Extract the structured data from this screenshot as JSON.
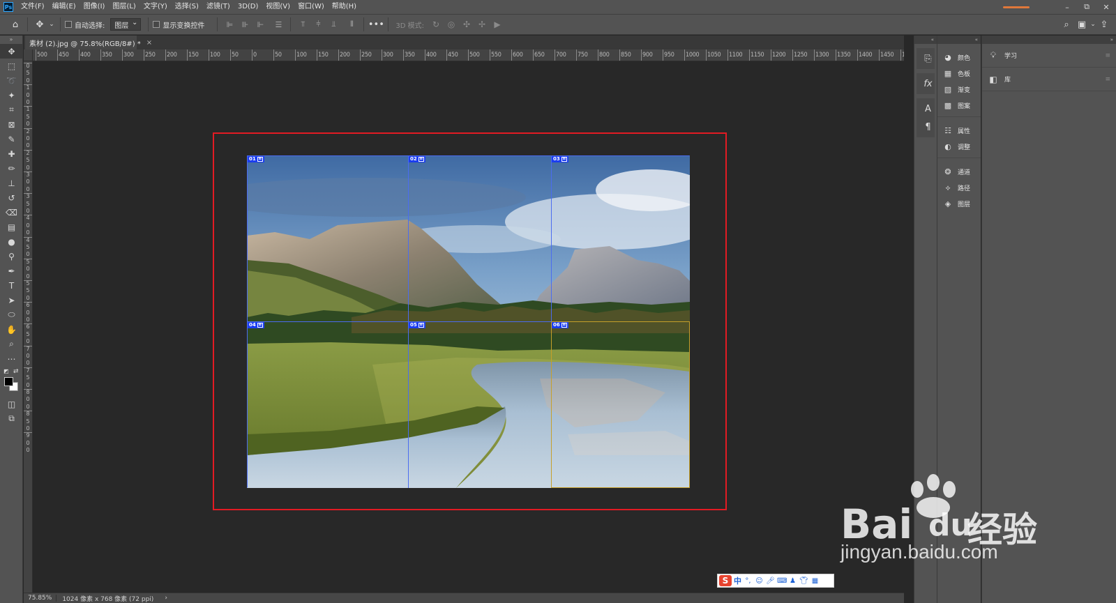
{
  "app": {
    "logo": "Ps"
  },
  "menu": [
    "文件(F)",
    "编辑(E)",
    "图像(I)",
    "图层(L)",
    "文字(Y)",
    "选择(S)",
    "滤镜(T)",
    "3D(D)",
    "视图(V)",
    "窗口(W)",
    "帮助(H)"
  ],
  "window_controls": {
    "minimize": "–",
    "restore": "⧉",
    "close": "✕"
  },
  "options": {
    "auto_select_label": "自动选择:",
    "auto_select_target": "图层",
    "show_transform_label": "显示变换控件",
    "more": "•••",
    "mode_3d_label": "3D 模式:"
  },
  "document": {
    "tab_title": "素材 (2).jpg @ 75.8%(RGB/8#) *",
    "tab_close": "×",
    "zoom": "75.85%",
    "info": "1024 像素 x 768 像素 (72 ppi)",
    "info_more": "›"
  },
  "ruler_h": [
    "500",
    "450",
    "400",
    "350",
    "300",
    "250",
    "200",
    "150",
    "100",
    "50",
    "0",
    "50",
    "100",
    "150",
    "200",
    "250",
    "300",
    "350",
    "400",
    "450",
    "500",
    "550",
    "600",
    "650",
    "700",
    "750",
    "800",
    "850",
    "900",
    "950",
    "1000",
    "1050",
    "1100",
    "1150",
    "1200",
    "1250",
    "1300",
    "1350",
    "1400",
    "1450",
    "15"
  ],
  "ruler_v": [
    "0",
    "5",
    "0",
    "1",
    "0",
    "0",
    "1",
    "5",
    "0",
    "2",
    "0",
    "0",
    "2",
    "5",
    "0",
    "3",
    "0",
    "0",
    "3",
    "5",
    "0",
    "4",
    "0",
    "0",
    "4",
    "5",
    "0",
    "5",
    "0",
    "0",
    "5",
    "5",
    "0",
    "6",
    "0",
    "0",
    "6",
    "5",
    "0",
    "7",
    "0",
    "0",
    "7",
    "5",
    "0",
    "8",
    "0",
    "0",
    "8",
    "5",
    "0",
    "9",
    "0",
    "0"
  ],
  "slices": [
    {
      "id": "01",
      "icon": "⊠"
    },
    {
      "id": "02",
      "icon": "⊠"
    },
    {
      "id": "03",
      "icon": "⊠"
    },
    {
      "id": "04",
      "icon": "⊠"
    },
    {
      "id": "05",
      "icon": "⊠"
    },
    {
      "id": "06",
      "icon": "⊠"
    }
  ],
  "panel_dock": {
    "group1": [
      "颜色",
      "色板",
      "渐变",
      "图案"
    ],
    "group2": [
      "属性",
      "调整"
    ],
    "group3": [
      "通道",
      "路径",
      "图层"
    ]
  },
  "panel_right": [
    "学习",
    "库"
  ],
  "watermark": {
    "brand": "Bai",
    "brand2": "du",
    "cn": "经验",
    "url": "jingyan.baidu.com"
  },
  "ime": {
    "logo": "S",
    "lang": "中"
  },
  "colors": {
    "highlight": "#e31b23",
    "slice_tag": "#1b3df0",
    "slice_line": "#4b6cf0",
    "slice_line_alt": "#c6a02a"
  }
}
